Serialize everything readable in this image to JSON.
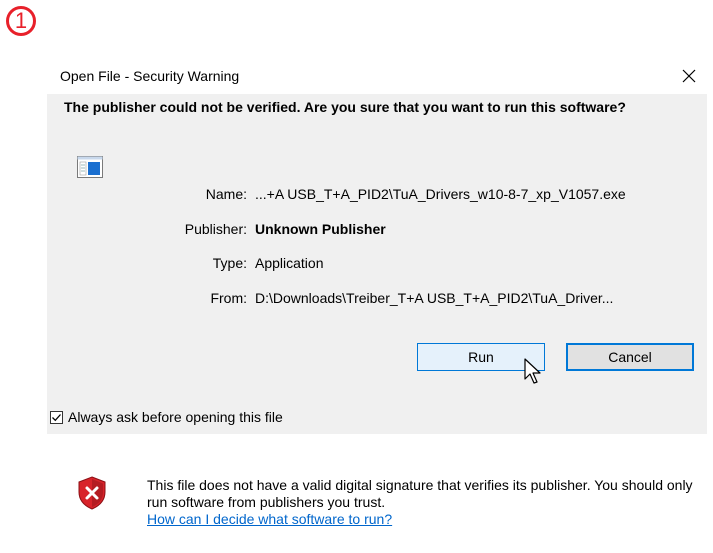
{
  "step_badge": "1",
  "dialog": {
    "title": "Open File - Security Warning",
    "headline": "The publisher could not be verified. Are you sure that you want to run this software?",
    "fields": {
      "name_label": "Name:",
      "name_value": "...+A USB_T+A_PID2\\TuA_Drivers_w10-8-7_xp_V1057.exe",
      "publisher_label": "Publisher:",
      "publisher_value": "Unknown Publisher",
      "type_label": "Type:",
      "type_value": "Application",
      "from_label": "From:",
      "from_value": "D:\\Downloads\\Treiber_T+A USB_T+A_PID2\\TuA_Driver..."
    },
    "buttons": {
      "run": "Run",
      "cancel": "Cancel"
    },
    "checkbox": {
      "label": "Always ask before opening this file",
      "checked": true
    },
    "footer": {
      "message": "This file does not have a valid digital signature that verifies its publisher. You should only run software from publishers you trust.",
      "link": "How can I decide what software to run?"
    }
  },
  "colors": {
    "badge": "#e8202a",
    "accent": "#0078d7",
    "link": "#0066cc",
    "warning_shield": "#d8232a"
  },
  "icons": [
    "close-icon",
    "application-icon",
    "mouse-cursor-icon",
    "checkmark-icon",
    "warning-shield-icon"
  ]
}
